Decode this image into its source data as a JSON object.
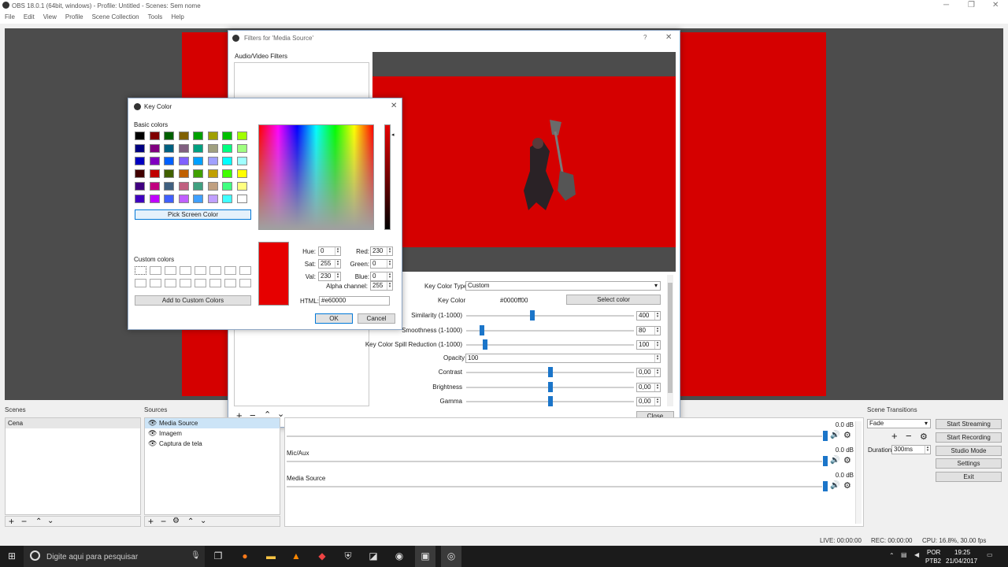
{
  "window": {
    "title": "OBS 18.0.1 (64bit, windows) - Profile: Untitled - Scenes: Sem nome"
  },
  "menu": [
    "File",
    "Edit",
    "View",
    "Profile",
    "Scene Collection",
    "Tools",
    "Help"
  ],
  "filters": {
    "title": "Filters for 'Media Source'",
    "help": "?",
    "close_x": "✕",
    "av_label": "Audio/Video Filters",
    "key_color_type_label": "Key Color Type",
    "key_color_type_value": "Custom",
    "key_color_label": "Key Color",
    "key_color_value": "#0000ff00",
    "select_color": "Select color",
    "sliders": [
      {
        "label": "Similarity (1-1000)",
        "value": "400",
        "frac": 0.39
      },
      {
        "label": "Smoothness (1-1000)",
        "value": "80",
        "frac": 0.08
      },
      {
        "label": "Key Color Spill Reduction (1-1000)",
        "value": "100",
        "frac": 0.1
      }
    ],
    "opacity_label": "Opacity",
    "opacity_value": "100",
    "sliders2": [
      {
        "label": "Contrast",
        "value": "0,00",
        "frac": 0.5
      },
      {
        "label": "Brightness",
        "value": "0,00",
        "frac": 0.5
      },
      {
        "label": "Gamma",
        "value": "0,00",
        "frac": 0.5
      }
    ],
    "close": "Close"
  },
  "keycolor": {
    "title": "Key Color",
    "basic_colors": "Basic colors",
    "pick_screen": "Pick Screen Color",
    "custom_colors": "Custom colors",
    "add_custom": "Add to Custom Colors",
    "hue_label": "Hue:",
    "hue": "0",
    "sat_label": "Sat:",
    "sat": "255",
    "val_label": "Val:",
    "val": "230",
    "red_label": "Red:",
    "red": "230",
    "green_label": "Green:",
    "green": "0",
    "blue_label": "Blue:",
    "blue": "0",
    "alpha_label": "Alpha channel:",
    "alpha": "255",
    "html_label": "HTML:",
    "html": "#e60000",
    "ok": "OK",
    "cancel": "Cancel",
    "swatches": [
      "#000000",
      "#800000",
      "#006000",
      "#806000",
      "#00a000",
      "#a0a000",
      "#00c000",
      "#a0ff00",
      "#000080",
      "#800080",
      "#006080",
      "#806080",
      "#00a080",
      "#a0a080",
      "#00ff80",
      "#a0ff80",
      "#0000c0",
      "#8000c0",
      "#0060ff",
      "#8060ff",
      "#00a0ff",
      "#a0a0ff",
      "#00ffff",
      "#a0ffff",
      "#400000",
      "#c00000",
      "#406000",
      "#c06000",
      "#40a000",
      "#c0a000",
      "#40ff00",
      "#ffff00",
      "#400080",
      "#c00080",
      "#406080",
      "#c06080",
      "#40a080",
      "#c0a080",
      "#40ff80",
      "#ffff80",
      "#4000c0",
      "#c000ff",
      "#4060ff",
      "#c060ff",
      "#40a0ff",
      "#c0a0ff",
      "#40ffff",
      "#ffffff"
    ],
    "current_color": "#e60000"
  },
  "docks": {
    "scenes": "Scenes",
    "sources": "Sources",
    "scene_item": "Cena",
    "source_items": [
      "Media Source",
      "Imagem",
      "Captura de tela"
    ],
    "scene_transitions": "Scene Transitions",
    "transition": "Fade",
    "duration_label": "Duration",
    "duration": "300ms",
    "mixer": [
      {
        "name": "",
        "db": "0.0 dB"
      },
      {
        "name": "Mic/Aux",
        "db": "0.0 dB"
      },
      {
        "name": "Media Source",
        "db": "0.0 dB"
      }
    ],
    "controls": [
      "Start Streaming",
      "Start Recording",
      "Studio Mode",
      "Settings",
      "Exit"
    ]
  },
  "status": {
    "live": "LIVE: 00:00:00",
    "rec": "REC: 00:00:00",
    "cpu": "CPU: 16.8%, 30.00 fps"
  },
  "taskbar": {
    "search": "Digite aqui para pesquisar",
    "lang1": "POR",
    "lang2": "PTB2",
    "time": "19:25",
    "date": "21/04/2017"
  }
}
